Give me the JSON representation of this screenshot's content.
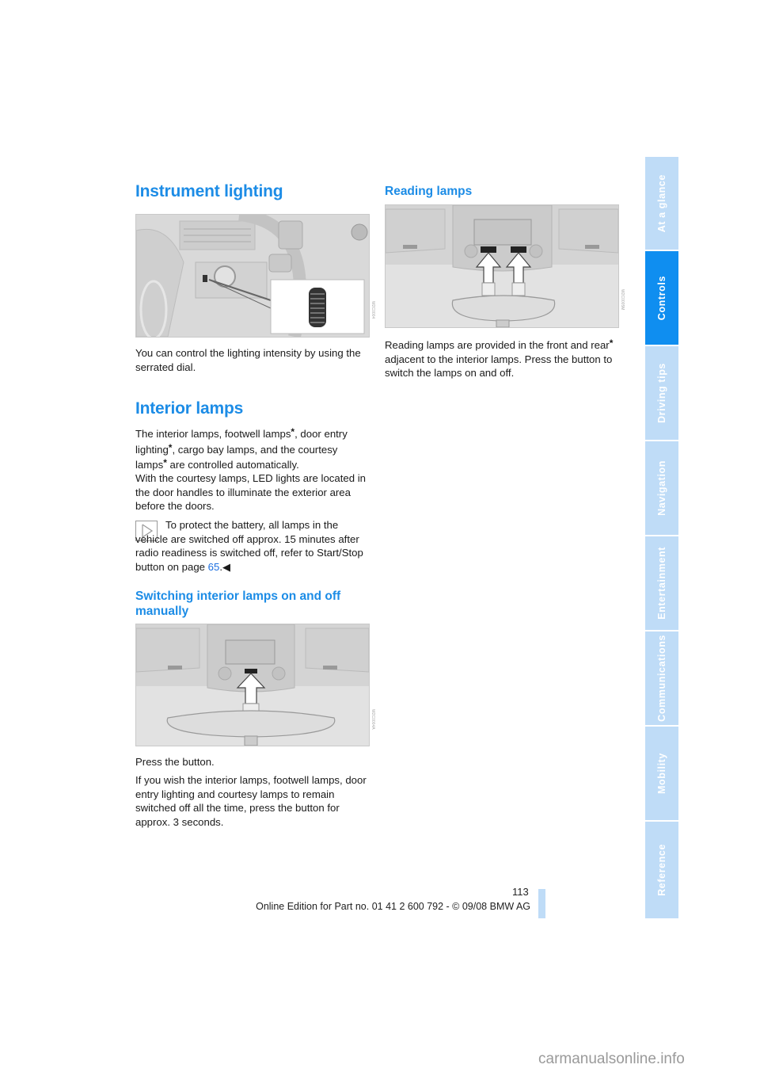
{
  "sections": {
    "instrument_lighting": {
      "title": "Instrument lighting",
      "body": "You can control the lighting intensity by using the serrated dial."
    },
    "interior_lamps": {
      "title": "Interior lamps",
      "para1_parts": [
        "The interior lamps, footwell lamps",
        "*",
        ", door entry lighting",
        "*",
        ", cargo bay lamps, and the courtesy lamps",
        "*",
        " are controlled automatically."
      ],
      "para2": "With the courtesy lamps, LED lights are located in the door handles to illuminate the exterior area before the doors.",
      "note_text": "To protect the battery, all lamps in the vehicle are switched off approx. 15 minutes after radio readiness is switched off, refer to Start/Stop button on page ",
      "note_link": "65",
      "note_end": ".◀"
    },
    "switching_manually": {
      "title": "Switching interior lamps on and off manually",
      "para1": "Press the button.",
      "para2": "If you wish the interior lamps, footwell lamps, door entry lighting and courtesy lamps to remain switched off all the time, press the button for approx. 3 seconds."
    },
    "reading_lamps": {
      "title": "Reading lamps",
      "body_parts": [
        "Reading lamps are provided in the front and rear",
        "*",
        " adjacent to the interior lamps. Press the button to switch the lamps on and off."
      ]
    }
  },
  "figures": {
    "instrument": {
      "code": "W2C0004"
    },
    "interior": {
      "code": "W2C0004A"
    },
    "reading": {
      "code": "W2C0005M"
    }
  },
  "side_tabs": [
    {
      "label": "At a glance",
      "active": false
    },
    {
      "label": "Controls",
      "active": true
    },
    {
      "label": "Driving tips",
      "active": false
    },
    {
      "label": "Navigation",
      "active": false
    },
    {
      "label": "Entertainment",
      "active": false
    },
    {
      "label": "Communications",
      "active": false
    },
    {
      "label": "Mobility",
      "active": false
    },
    {
      "label": "Reference",
      "active": false
    }
  ],
  "footer": {
    "page_number": "113",
    "edition": "Online Edition for Part no. 01 41 2 600 792 - © 09/08 BMW AG",
    "watermark": "carmanualsonline.info"
  },
  "colors": {
    "accent": "#1c8ce6",
    "tab_active": "#0f8ef0",
    "tab_inactive": "#bfdcf7"
  }
}
